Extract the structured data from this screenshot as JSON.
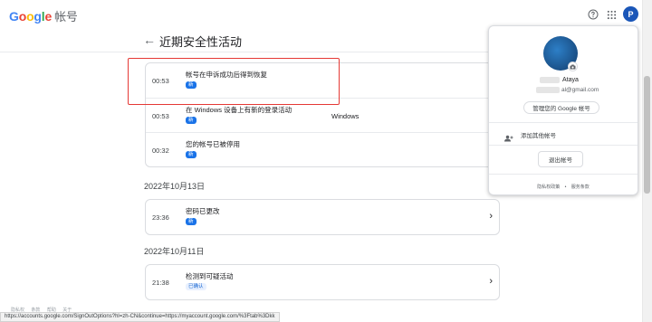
{
  "header": {
    "logo_letters": [
      "G",
      "o",
      "o",
      "g",
      "l",
      "e"
    ],
    "logo_colors": [
      "#4285f4",
      "#ea4335",
      "#fbbc05",
      "#4285f4",
      "#34a853",
      "#ea4335"
    ],
    "title": "帐号",
    "help_icon": "help-circle-icon",
    "apps_icon": "apps-grid-icon",
    "avatar_letter": "P"
  },
  "page": {
    "back_icon": "←",
    "title": "近期安全性活动"
  },
  "groups": [
    {
      "date": "",
      "events": [
        {
          "time": "00:53",
          "label": "帐号在申诉成功后得到恢复",
          "badge": "新",
          "device": ""
        },
        {
          "time": "00:53",
          "label": "在 Windows 设备上有新的登录活动",
          "badge": "新",
          "device": "Windows"
        },
        {
          "time": "00:32",
          "label": "您的帐号已被停用",
          "badge": "新",
          "device": ""
        }
      ]
    },
    {
      "date": "2022年10月13日",
      "events": [
        {
          "time": "23:36",
          "label": "密码已更改",
          "badge": "新",
          "device": ""
        }
      ]
    },
    {
      "date": "2022年10月11日",
      "events": [
        {
          "time": "21:38",
          "label": "检测到可疑活动",
          "badge": "已确认",
          "device": ""
        }
      ]
    }
  ],
  "footer": {
    "links": [
      "隐私权",
      "条款",
      "帮助",
      "关于"
    ]
  },
  "status_url": "https://accounts.google.com/SignOutOptions?hl=zh-CN&continue=https://myaccount.google.com/%3Ftab%3Dkk",
  "popup": {
    "name": "Ataya",
    "email": "al@gmail.com",
    "manage_label": "管理您的 Google 帐号",
    "add_account_label": "添加其他帐号",
    "signout_label": "退出帐号",
    "privacy_label": "隐私权政策",
    "separator": "•",
    "terms_label": "服务条款"
  },
  "chevron": "›"
}
